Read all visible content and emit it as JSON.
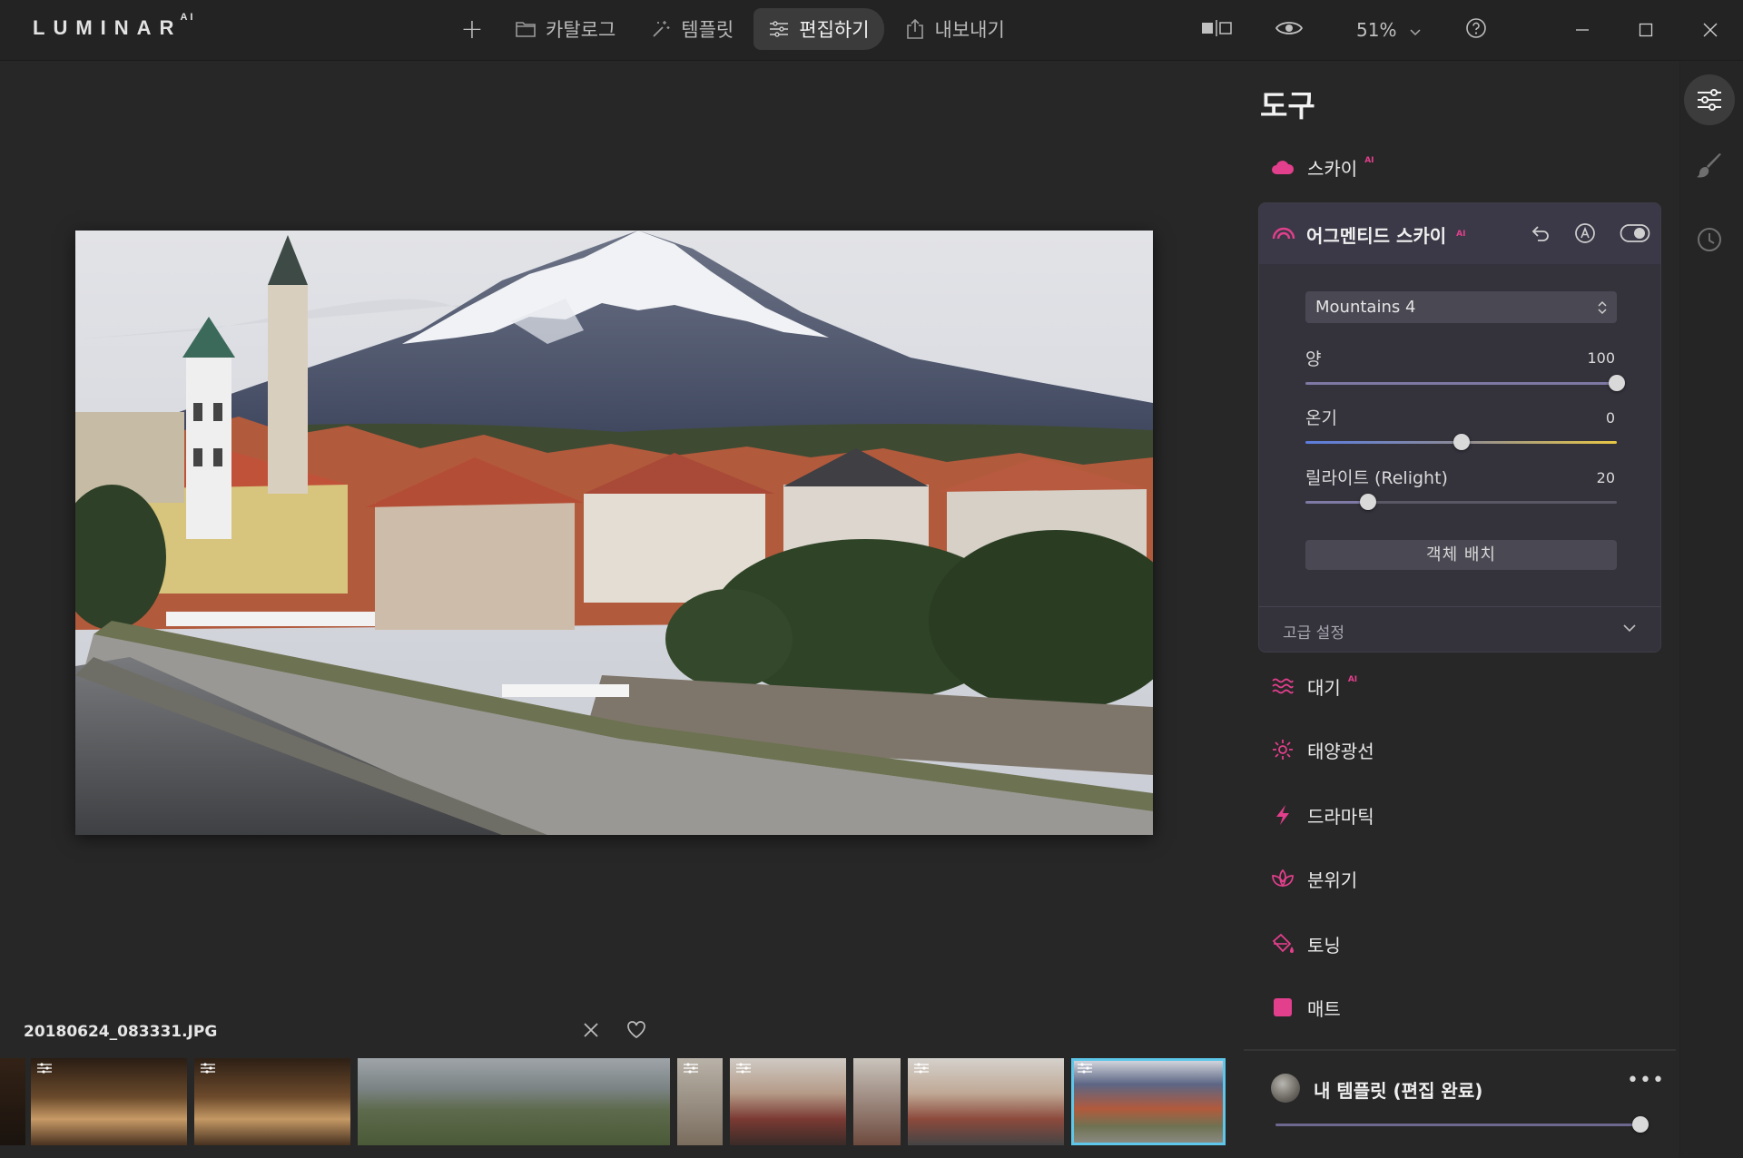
{
  "app": {
    "logo": "LUMINAR",
    "logo_sup": "AI"
  },
  "nav": {
    "add_label": "+",
    "items": [
      {
        "label": "카탈로그",
        "icon": "folder-icon"
      },
      {
        "label": "템플릿",
        "icon": "magic-wand-icon"
      },
      {
        "label": "편집하기",
        "icon": "sliders-icon",
        "active": true
      },
      {
        "label": "내보내기",
        "icon": "share-icon"
      }
    ]
  },
  "toolbar": {
    "zoom": "51%"
  },
  "panel": {
    "title": "도구",
    "tools": [
      {
        "label": "스카이",
        "ai": "AI",
        "icon": "cloud-icon"
      },
      {
        "label": "대기",
        "ai": "AI",
        "icon": "waves-icon"
      },
      {
        "label": "태양광선",
        "ai": "",
        "icon": "sun-icon"
      },
      {
        "label": "드라마틱",
        "ai": "",
        "icon": "lightning-icon"
      },
      {
        "label": "분위기",
        "ai": "",
        "icon": "lotus-icon"
      },
      {
        "label": "토닝",
        "ai": "",
        "icon": "paint-bucket-icon"
      },
      {
        "label": "매트",
        "ai": "",
        "icon": "square-icon"
      }
    ],
    "augmented_sky": {
      "title": "어그멘티드 스카이",
      "ai": "AI",
      "select_value": "Mountains 4",
      "sliders": [
        {
          "label": "양",
          "value": "100",
          "fraction": 1.0,
          "gradient": false
        },
        {
          "label": "온기",
          "value": "0",
          "fraction": 0.5,
          "gradient": true
        },
        {
          "label": "릴라이트 (Relight)",
          "value": "20",
          "fraction": 0.2,
          "gradient": false
        }
      ],
      "place_button": "객체 배치",
      "advanced_label": "고급 설정"
    },
    "template": {
      "title": "내 템플릿 (편집 완료)",
      "more": "•••",
      "amount_fraction": 1.0
    }
  },
  "filmstrip": {
    "filename": "20180624_083331.JPG"
  },
  "colors": {
    "accent": "#e23f8c",
    "selection": "#5ec7e9"
  }
}
